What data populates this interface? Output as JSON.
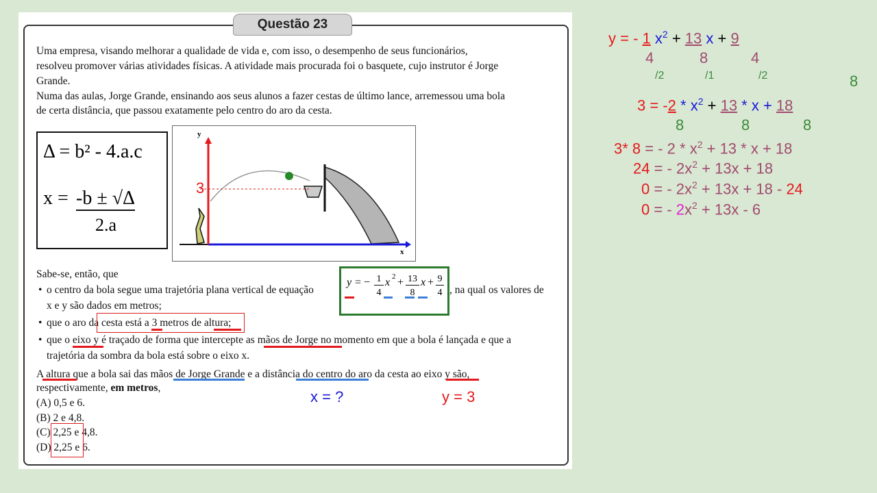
{
  "question": {
    "title": "Questão 23",
    "intro_lines": [
      "Uma empresa, visando melhorar a qualidade de vida e, com isso, o desempenho de seus funcionários,",
      "resolveu promover várias atividades físicas. A atividade mais procurada foi o basquete, cujo instrutor é Jorge",
      "Grande.",
      "Numa das aulas, Jorge Grande, ensinando aos seus alunos a fazer cestas de último lance, arremessou uma bola",
      "de certa distância, que passou exatamente pelo centro do aro da cesta."
    ],
    "formulas": {
      "delta": "Δ = b² - 4.a.c",
      "x_num": "-b ± √Δ",
      "x_prefix": "x =",
      "x_den": "2.a"
    },
    "graph": {
      "y_axis": "y",
      "x_axis": "x",
      "height_label": "3"
    },
    "sabe_se": "Sabe-se, então, que",
    "bullets": [
      {
        "pre": "o centro da bola segue uma trajetória plana vertical de equação",
        "post": ", na qual os valores de",
        "cont": "x e y são dados em metros;"
      },
      {
        "text": "que o aro da cesta está a 3 metros de altura;"
      },
      {
        "line1": "que o eixo y é traçado de forma que intercepte as mãos de Jorge no momento em que a bola é lançada e que a",
        "line2": "trajetória da sombra da bola está sobre o eixo x."
      }
    ],
    "equation": {
      "y": "y",
      "eq": "= −",
      "a_num": "1",
      "a_den": "4",
      "x2": "x",
      "sq": "2",
      "plus1": "+",
      "b_num": "13",
      "b_den": "8",
      "x1": "x",
      "plus2": "+",
      "c_num": "9",
      "c_den": "4"
    },
    "ask_line1": "A altura que a bola sai das mãos de Jorge Grande e a distância do centro do aro da cesta ao eixo y são,",
    "ask_line2_a": "respectivamente, ",
    "ask_line2_b": "em metros",
    "ask_line2_c": ",",
    "choices": [
      "(A) 0,5 e 6.",
      "(B) 2 e 4,8.",
      "(C) 2,25 e 4,8.",
      "(D) 2,25 e 6."
    ],
    "annotations": {
      "x_unknown": "x = ?",
      "y_known": "y = 3"
    }
  },
  "work": {
    "line1": {
      "y": "y = ",
      "minus": "- ",
      "a_num": "1",
      "x2": " x",
      "sq": "2",
      "p1": " + ",
      "b_num": "13",
      "x1": " x",
      "p2": " + ",
      "c_num": "9",
      "a_den": "4",
      "b_den": "8",
      "c_den": "4"
    },
    "divisors": [
      "/2",
      "/1",
      "/2"
    ],
    "lcm": "8",
    "line2": {
      "lhs": "3",
      "eq": " = -",
      "a_num": "2",
      "t1": " * x",
      "sq": "2",
      "p1": " + ",
      "b_num": "13",
      "t2": " * x + ",
      "c_num": "18",
      "a_den": "8",
      "b_den": "8",
      "c_den": "8"
    },
    "line3": {
      "lhs": "3* 8",
      "rest": " = - 2 * x",
      "sq": "2",
      "rest2": " + 13 * x +  18"
    },
    "line4": {
      "lhs": "24",
      "a": " = - 2x",
      "sq": "2",
      "b": "  +  13x  +  18"
    },
    "line5": {
      "lhs": "0",
      "a": " = - 2x",
      "sq": "2",
      "b": " + 13x + 18 - ",
      "c": "24"
    },
    "line6": {
      "lhs": "0",
      "a": " = - ",
      "two": "2",
      "x": "x",
      "sq": "2",
      "b": " + 13x - 6"
    }
  },
  "colors": {
    "red": "#e3191b",
    "blue": "#1a1ad8",
    "mauve": "#a04a6e",
    "green": "#3a8a3a",
    "magenta": "#e020d0"
  }
}
